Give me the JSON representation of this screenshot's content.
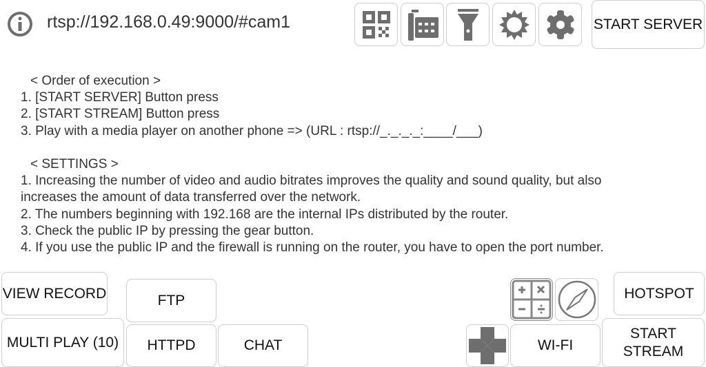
{
  "header": {
    "url": "rtsp://192.168.0.49:9000/#cam1",
    "start_server": "START SERVER",
    "icons": [
      "info-icon",
      "qr-code-icon",
      "keyboard-icon",
      "flashlight-icon",
      "brightness-icon",
      "settings-gear-icon"
    ]
  },
  "instructions": {
    "order_title": "< Order of execution >",
    "order": [
      "1. [START SERVER] Button press",
      "2. [START STREAM] Button press",
      "3. Play with a media player on another phone => (URL : rtsp://_._._._:____/___)"
    ],
    "settings_title": "< SETTINGS >",
    "settings": [
      "1. Increasing the number of video and audio bitrates improves the quality and sound quality, but also",
      "increases the amount of data transferred over the network.",
      "2. The numbers beginning with 192.168 are the internal IPs distributed by the router.",
      "3. Check the public IP by pressing the gear button.",
      "4. If you use the public IP and the firewall is running on the router, you have to open the port number."
    ]
  },
  "buttons": {
    "view_record": "VIEW RECORD",
    "ftp": "FTP",
    "multi_play": "MULTI PLAY (10)",
    "httpd": "HTTPD",
    "chat": "CHAT",
    "hotspot": "HOTSPOT",
    "wifi": "WI-FI",
    "start_stream": "START\nSTREAM"
  },
  "colors": {
    "icon": "#6e6e6e",
    "border": "#cfcfcf"
  }
}
